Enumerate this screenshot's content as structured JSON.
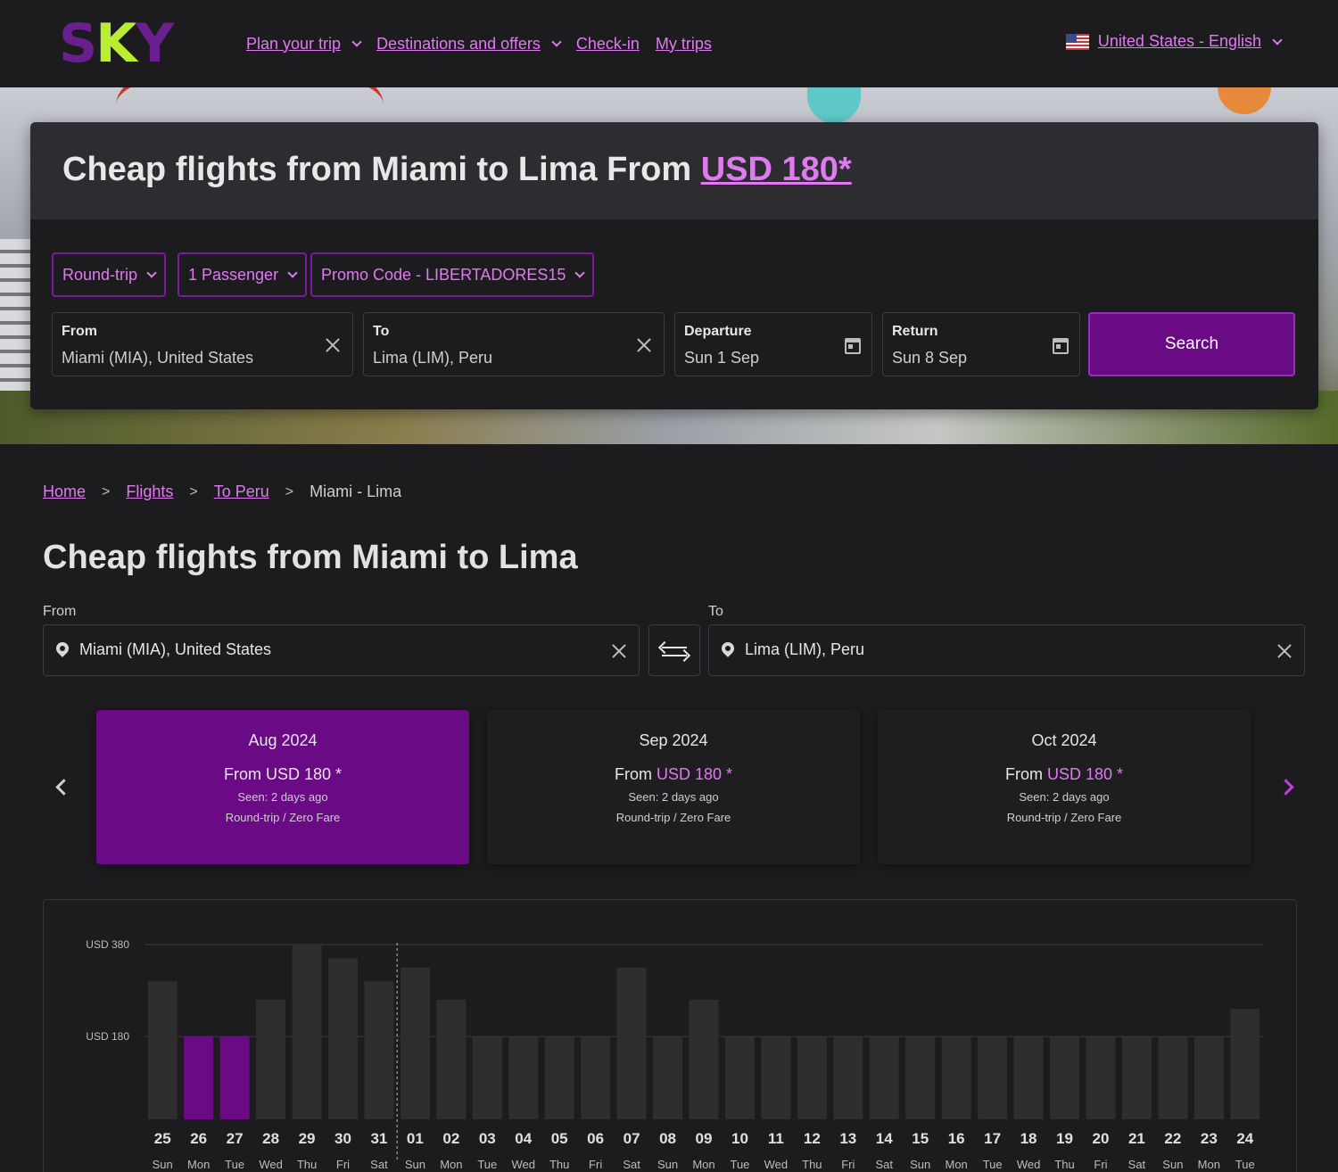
{
  "nav": {
    "logo_left": "S",
    "logo_mid": "K",
    "logo_right": "Y",
    "plan_trip": "Plan your trip",
    "destinations": "Destinations and offers",
    "checkin": "Check-in",
    "my_trips": "My trips",
    "language": "United States - English",
    "flag_icon": "us-flag-icon"
  },
  "hero": {
    "title_prefix": "Cheap flights from Miami to Lima From ",
    "title_price": "USD 180*",
    "trip_type": "Round-trip",
    "passengers": "1 Passenger",
    "promo": "Promo Code - LIBERTADORES15",
    "from_label": "From",
    "from_value": "Miami (MIA), United States",
    "to_label": "To",
    "to_value": "Lima (LIM), Peru",
    "departure_label": "Departure",
    "departure_value": "Sun 1 Sep",
    "return_label": "Return",
    "return_value": "Sun 8 Sep",
    "search_label": "Search"
  },
  "breadcrumb": {
    "home": "Home",
    "flights": "Flights",
    "to_peru": "To Peru",
    "current": "Miami - Lima"
  },
  "page_title": "Cheap flights from Miami to Lima",
  "route": {
    "from_label": "From",
    "from_value": "Miami (MIA), United States",
    "to_label": "To",
    "to_value": "Lima (LIM), Peru"
  },
  "months": [
    {
      "title": "Aug 2024",
      "from_text": "From ",
      "price": "USD 180",
      "asterisk": " *",
      "seen": "Seen: 2 days ago",
      "fare": "Round-trip / Zero Fare",
      "active": true
    },
    {
      "title": "Sep 2024",
      "from_text": "From ",
      "price": "USD 180",
      "asterisk": " *",
      "seen": "Seen: 2 days ago",
      "fare": "Round-trip / Zero Fare",
      "active": false
    },
    {
      "title": "Oct 2024",
      "from_text": "From ",
      "price": "USD 180",
      "asterisk": " *",
      "seen": "Seen: 2 days ago",
      "fare": "Round-trip / Zero Fare",
      "active": false
    }
  ],
  "colors": {
    "accent": "#6a0a85",
    "link": "#e07af0",
    "bar": "#2e2e31",
    "bar_highlight": "#6a0a85",
    "background": "#1c1c1f"
  },
  "chart_data": {
    "type": "bar",
    "ytick_labels": [
      "USD 380",
      "USD 180"
    ],
    "ytick_values": [
      380,
      180
    ],
    "ylim": [
      0,
      380
    ],
    "grid": true,
    "legend": "none",
    "month_divider_after_index": 6,
    "highlighted_indices": [
      1,
      2
    ],
    "days": [
      "25",
      "26",
      "27",
      "28",
      "29",
      "30",
      "31",
      "01",
      "02",
      "03",
      "04",
      "05",
      "06",
      "07",
      "08",
      "09",
      "10",
      "11",
      "12",
      "13",
      "14",
      "15",
      "16",
      "17",
      "18",
      "19",
      "20",
      "21",
      "22",
      "23",
      "24"
    ],
    "weekdays": [
      "Sun",
      "Mon",
      "Tue",
      "Wed",
      "Thu",
      "Fri",
      "Sat",
      "Sun",
      "Mon",
      "Tue",
      "Wed",
      "Thu",
      "Fri",
      "Sat",
      "Sun",
      "Mon",
      "Tue",
      "Wed",
      "Thu",
      "Fri",
      "Sat",
      "Sun",
      "Mon",
      "Tue",
      "Wed",
      "Thu",
      "Fri",
      "Sat",
      "Sun",
      "Mon",
      "Tue"
    ],
    "values": [
      300,
      180,
      180,
      260,
      380,
      350,
      300,
      330,
      260,
      180,
      180,
      180,
      180,
      330,
      180,
      260,
      180,
      180,
      180,
      180,
      180,
      180,
      180,
      180,
      180,
      180,
      180,
      180,
      180,
      180,
      240
    ]
  }
}
